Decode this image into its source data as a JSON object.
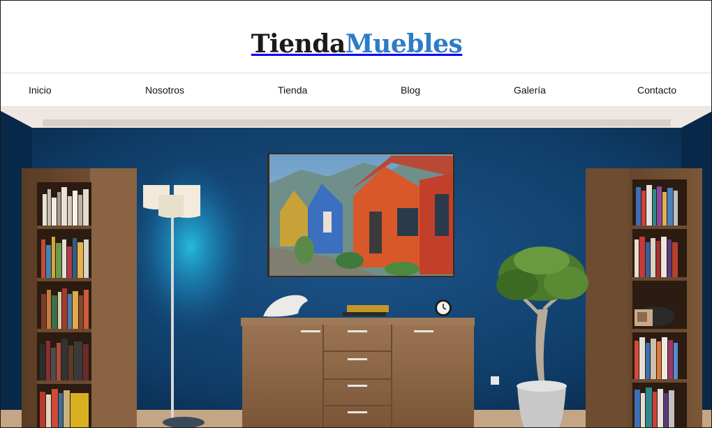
{
  "brand": {
    "part1": "Tienda",
    "part2": "Muebles"
  },
  "nav": {
    "items": [
      {
        "label": "Inicio"
      },
      {
        "label": "Nosotros"
      },
      {
        "label": "Tienda"
      },
      {
        "label": "Blog"
      },
      {
        "label": "Galería"
      },
      {
        "label": "Contacto"
      }
    ]
  },
  "colors": {
    "brand_dark": "#1a1a1a",
    "brand_accent": "#2d7cc6",
    "wall": "#0e3a63"
  }
}
